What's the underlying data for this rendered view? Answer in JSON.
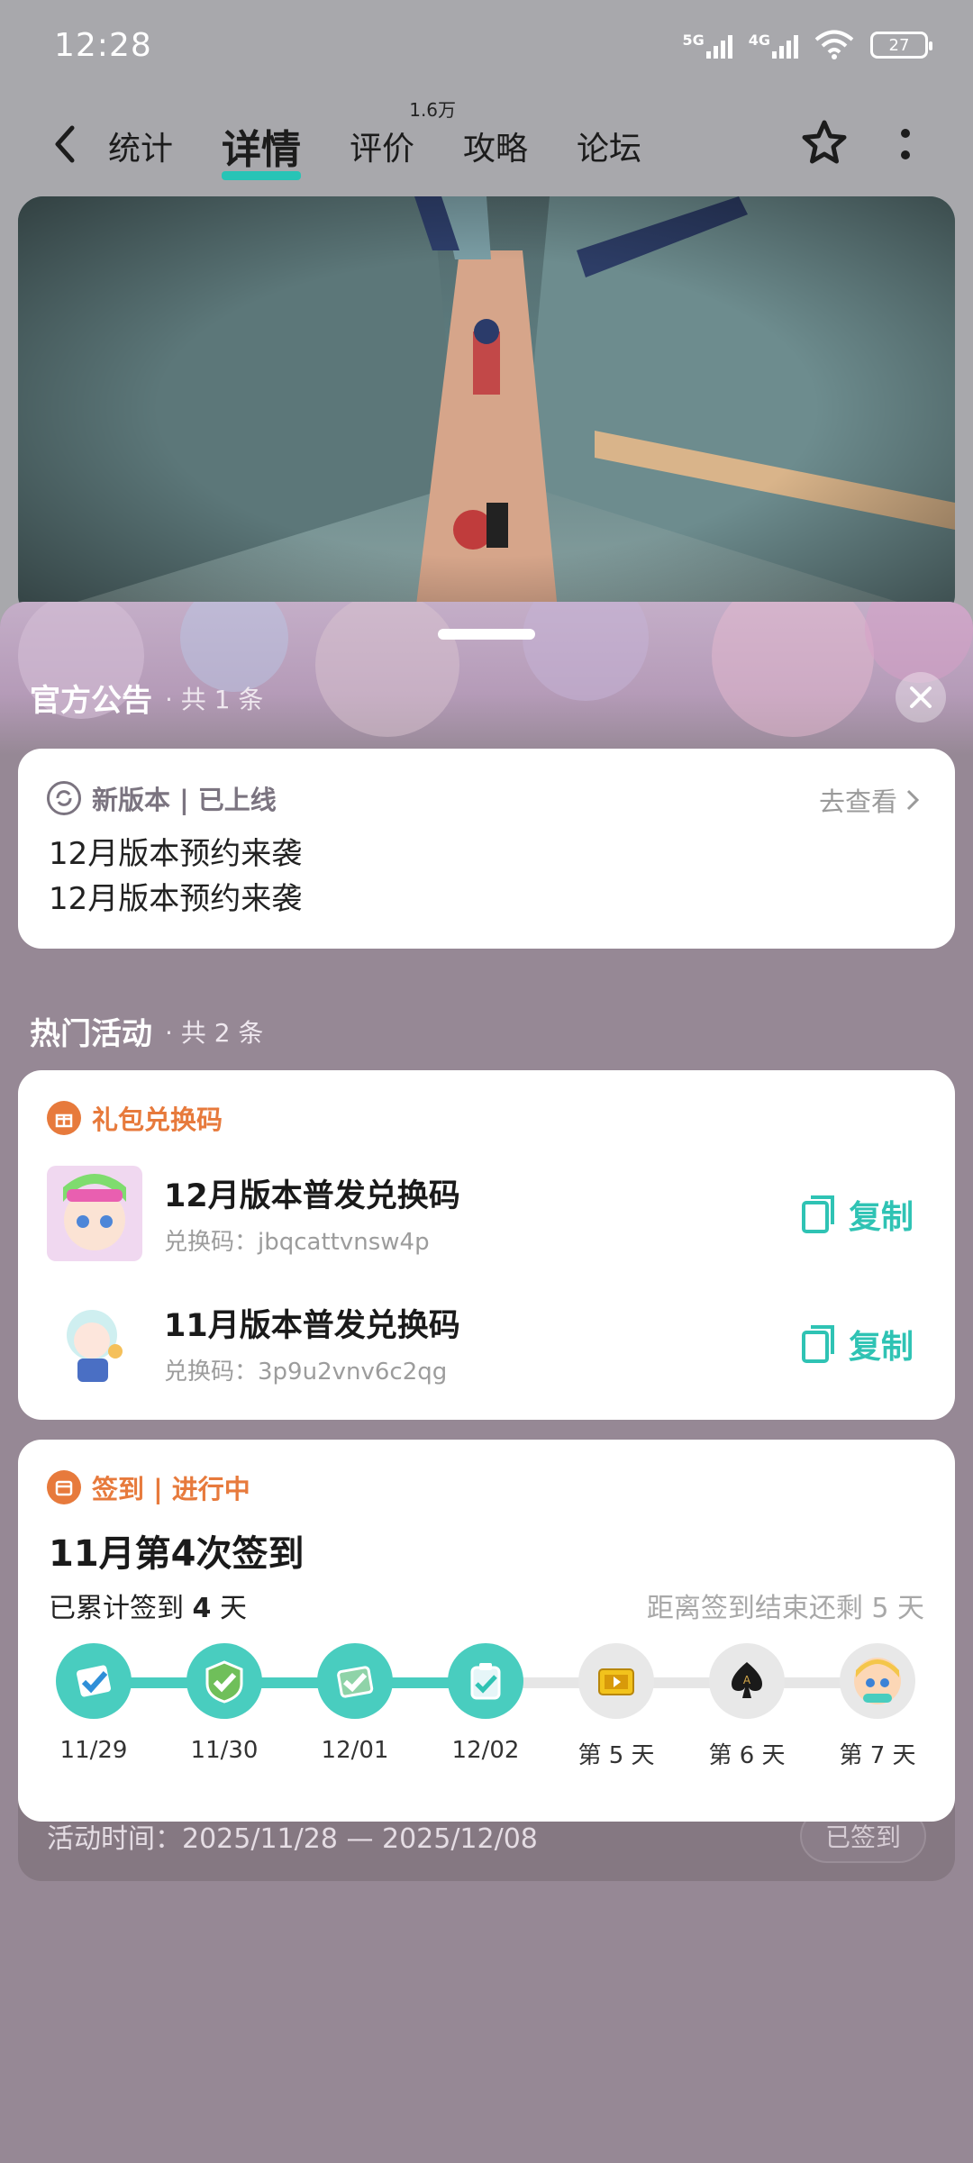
{
  "status_bar": {
    "time": "12:28",
    "net1": "5G",
    "net2": "4G",
    "battery": "27"
  },
  "nav": {
    "tabs": [
      {
        "label": "统计"
      },
      {
        "label": "详情"
      },
      {
        "label": "评价",
        "badge": "1.6万"
      },
      {
        "label": "攻略"
      },
      {
        "label": "论坛"
      }
    ]
  },
  "announcement": {
    "section_title": "官方公告",
    "section_count": "· 共 1 条",
    "tag": "新版本 | 已上线",
    "link": "去查看",
    "lines": [
      "12月版本预约来袭",
      "12月版本预约来袭"
    ]
  },
  "activities": {
    "section_title": "热门活动",
    "section_count": "· 共 2 条",
    "gift": {
      "tag": "礼包兑换码",
      "items": [
        {
          "title": "12月版本普发兑换码",
          "code": "兑换码：jbqcattvnsw4p",
          "action": "复制"
        },
        {
          "title": "11月版本普发兑换码",
          "code": "兑换码：3p9u2vnv6c2qg",
          "action": "复制"
        }
      ]
    },
    "signin": {
      "tag": "签到 | 进行中",
      "title": "11月第4次签到",
      "count_prefix": "已累计签到 ",
      "count_value": "4",
      "count_suffix": " 天",
      "remaining": "距离签到结束还剩 5 天",
      "progress": 0.52,
      "days": [
        {
          "label": "11/29",
          "icon": "checked-icon"
        },
        {
          "label": "11/30",
          "icon": "checked-icon"
        },
        {
          "label": "12/01",
          "icon": "checked-icon"
        },
        {
          "label": "12/02",
          "icon": "checked-icon"
        },
        {
          "label": "第 5 天",
          "icon": "ticket-icon"
        },
        {
          "label": "第 6 天",
          "icon": "spade-card-icon"
        },
        {
          "label": "第 7 天",
          "icon": "avatar-icon"
        }
      ],
      "period": "活动时间：2025/11/28 — 2025/12/08",
      "status_button": "已签到"
    }
  },
  "colors": {
    "accent": "#27c4b6",
    "orange": "#e77a3c",
    "sheet_bg": "#968895"
  }
}
